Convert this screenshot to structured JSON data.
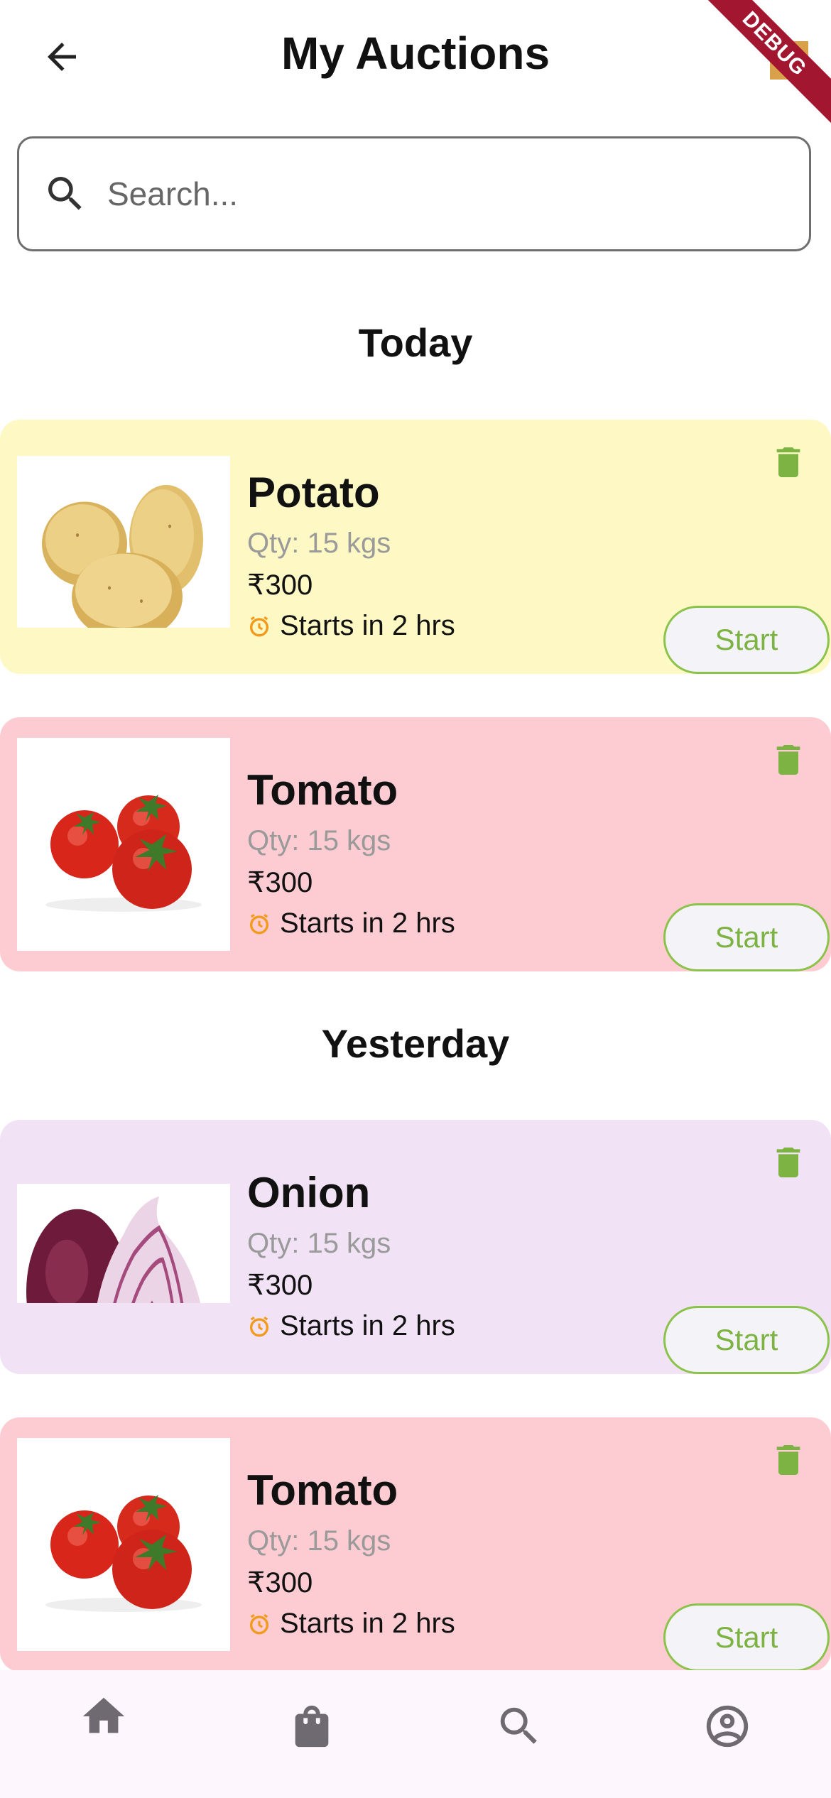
{
  "appbar": {
    "title": "My Auctions",
    "debug_label": "DEBUG"
  },
  "search": {
    "placeholder": "Search...",
    "value": ""
  },
  "sections": [
    {
      "heading": "Today",
      "items": [
        {
          "name": "Potato",
          "qty": "Qty: 15 kgs",
          "price": "₹300",
          "starts": "Starts in 2 hrs",
          "start_label": "Start",
          "bg": "#fdf8c4"
        },
        {
          "name": "Tomato",
          "qty": "Qty: 15 kgs",
          "price": "₹300",
          "starts": "Starts in 2 hrs",
          "start_label": "Start",
          "bg": "#fdccd2"
        }
      ]
    },
    {
      "heading": "Yesterday",
      "items": [
        {
          "name": "Onion",
          "qty": "Qty: 15 kgs",
          "price": "₹300",
          "starts": "Starts in 2 hrs",
          "start_label": "Start",
          "bg": "#f1e3f5"
        },
        {
          "name": "Tomato",
          "qty": "Qty: 15 kgs",
          "price": "₹300",
          "starts": "Starts in 2 hrs",
          "start_label": "Start",
          "bg": "#fdccd2"
        }
      ]
    }
  ],
  "bottom_nav": [
    "home-icon",
    "shopping-bag-icon",
    "search-icon",
    "account-circle-icon"
  ],
  "colors": {
    "accent_green": "#7cb342",
    "timer_orange": "#f29a1c",
    "debug_ribbon": "#a3162f"
  }
}
